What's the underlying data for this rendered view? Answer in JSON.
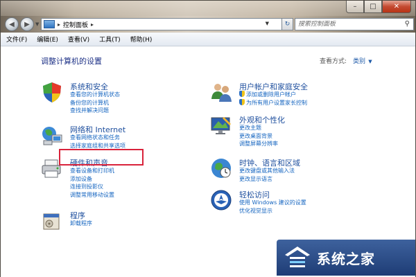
{
  "window": {
    "caption_minimize": "–",
    "caption_maximize": "□",
    "caption_close": "✕"
  },
  "address_bar": {
    "path": "控制面板",
    "separator": "▸",
    "trailing_separator": "▸",
    "search_placeholder": "搜索控制面板"
  },
  "menu": [
    {
      "label": "文件(F)"
    },
    {
      "label": "编辑(E)"
    },
    {
      "label": "查看(V)"
    },
    {
      "label": "工具(T)"
    },
    {
      "label": "帮助(H)"
    }
  ],
  "content": {
    "title": "调整计算机的设置",
    "view_by_label": "查看方式:",
    "view_by_value": "类别"
  },
  "categories_left": [
    {
      "title": "系统和安全",
      "icon": "shield-flag-icon",
      "links": [
        "查看您的计算机状态",
        "备份您的计算机",
        "查找并解决问题"
      ]
    },
    {
      "title": "网络和 Internet",
      "icon": "network-globe-icon",
      "links": [
        "查看网络状态和任务",
        "选择家庭组和共享选项"
      ]
    },
    {
      "title": "硬件和声音",
      "icon": "printer-icon",
      "links": [
        "查看设备和打印机",
        "添加设备",
        "连接到投影仪",
        "调整常用移动设置"
      ]
    },
    {
      "title": "程序",
      "icon": "programs-icon",
      "links": [
        "卸载程序"
      ]
    }
  ],
  "categories_right": [
    {
      "title": "用户帐户和家庭安全",
      "icon": "users-icon",
      "links": [
        "添加或删除用户帐户",
        "为所有用户设置家长控制"
      ]
    },
    {
      "title": "外观和个性化",
      "icon": "display-icon",
      "links": [
        "更改主题",
        "更改桌面背景",
        "调整屏幕分辨率"
      ]
    },
    {
      "title": "时钟、语言和区域",
      "icon": "clock-globe-icon",
      "links": [
        "更改键盘或其他输入法",
        "更改显示语言"
      ]
    },
    {
      "title": "轻松访问",
      "icon": "ease-of-access-icon",
      "links": [
        "使用 Windows 建议的设置",
        "优化视觉显示"
      ]
    }
  ],
  "watermark": {
    "text": "系统之家"
  }
}
